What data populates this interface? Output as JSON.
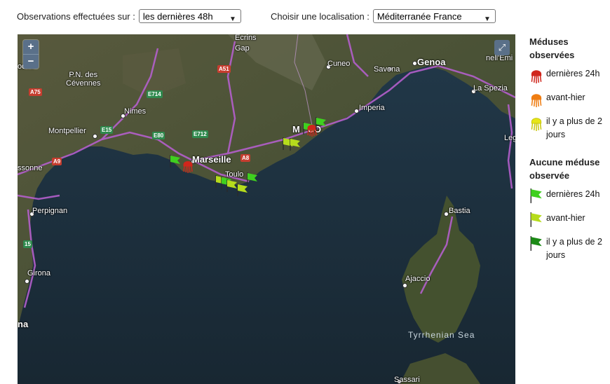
{
  "filters": {
    "period_label": "Observations effectuées sur :",
    "period_value": "les dernières 48h",
    "location_label": "Choisir une localisation :",
    "location_value": "Méditerranée France"
  },
  "map": {
    "zoom_in": "+",
    "zoom_out": "−",
    "fullscreen_icon": "⤢",
    "places": {
      "ecrins": "Écrins",
      "gap": "Gap",
      "cuneo": "Cuneo",
      "savona": "Savona",
      "genoa": "Genoa",
      "pn_cevennes": "P.N. des\nCévennes",
      "nimes": "Nimes",
      "montpellier": "Montpellier",
      "marseille": "Marseille",
      "toulon": "Toulo",
      "imperia": "Imperia",
      "monaco": "M   CO",
      "la_spezia": "La Spezia",
      "nell_emi": "nell'Emi",
      "leg": "Leg",
      "bastia": "Bastia",
      "ajaccio": "Ajaccio",
      "perpignan": "Perpignan",
      "girona": "Girona",
      "carcassonne": "ssonne",
      "rodez": "odez",
      "na": "na",
      "sassari": "Sassari",
      "tyrrhenian": "Tyrrhenian Sea"
    },
    "shields": {
      "a75": "A75",
      "a51": "A51",
      "e714": "E714",
      "e15": "E15",
      "e80": "E80",
      "e712": "E712",
      "a8": "A8",
      "a9": "A9",
      "r15": "15"
    }
  },
  "legend": {
    "jelly_title": "Méduses observées",
    "jelly_items": [
      {
        "label": "dernières 24h",
        "color": "#d0261c"
      },
      {
        "label": "avant-hier",
        "color": "#ef7d12"
      },
      {
        "label": "il y a plus de 2 jours",
        "color": "#e7e617"
      }
    ],
    "none_title": "Aucune méduse observée",
    "flag_items": [
      {
        "label": "dernières 24h",
        "color": "#3fd01f"
      },
      {
        "label": "avant-hier",
        "color": "#b6dc1c"
      },
      {
        "label": "il y a plus de 2 jours",
        "color": "#1c8a16"
      }
    ]
  }
}
